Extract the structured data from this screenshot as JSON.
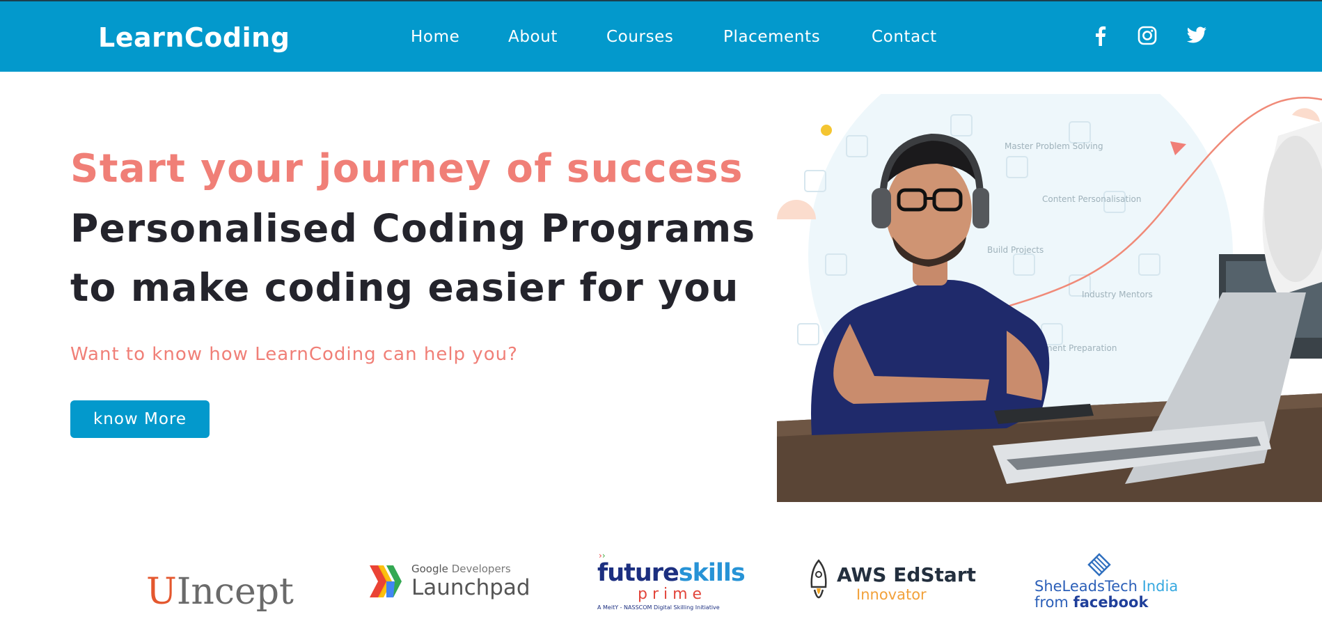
{
  "brand": {
    "name": "LearnCoding"
  },
  "nav": {
    "items": [
      {
        "label": "Home"
      },
      {
        "label": "About"
      },
      {
        "label": "Courses"
      },
      {
        "label": "Placements"
      },
      {
        "label": "Contact"
      }
    ],
    "social": [
      "facebook-icon",
      "instagram-icon",
      "twitter-icon"
    ]
  },
  "hero": {
    "headline": "Start your journey of success",
    "line2": "Personalised Coding Programs",
    "line3": "to make coding easier for you",
    "subtext": "Want to know how LearnCoding can help you?",
    "cta_label": "know More",
    "image_labels": [
      "Master Problem Solving",
      "Content Personalisation",
      "Build Projects",
      "Industry Mentors",
      "Placement Preparation"
    ]
  },
  "partners": {
    "uincept": {
      "u": "U",
      "rest": "Incept"
    },
    "google": {
      "google": "Google",
      "developers": "Developers",
      "launchpad": "Launchpad"
    },
    "futureskills": {
      "future": "future",
      "skills": "skills",
      "prime": "p r i m e",
      "tagline": "A MeitY - NASSCOM Digital Skilling Initiative"
    },
    "aws": {
      "title": "AWS EdStart",
      "sub": "Innovator"
    },
    "sheleads": {
      "line1a": "SheLeadsTech",
      "line1b": "India",
      "from": "from",
      "facebook": "facebook"
    }
  },
  "colors": {
    "primary": "#0399cc",
    "accent": "#f07f77",
    "text_dark": "#24242c"
  }
}
